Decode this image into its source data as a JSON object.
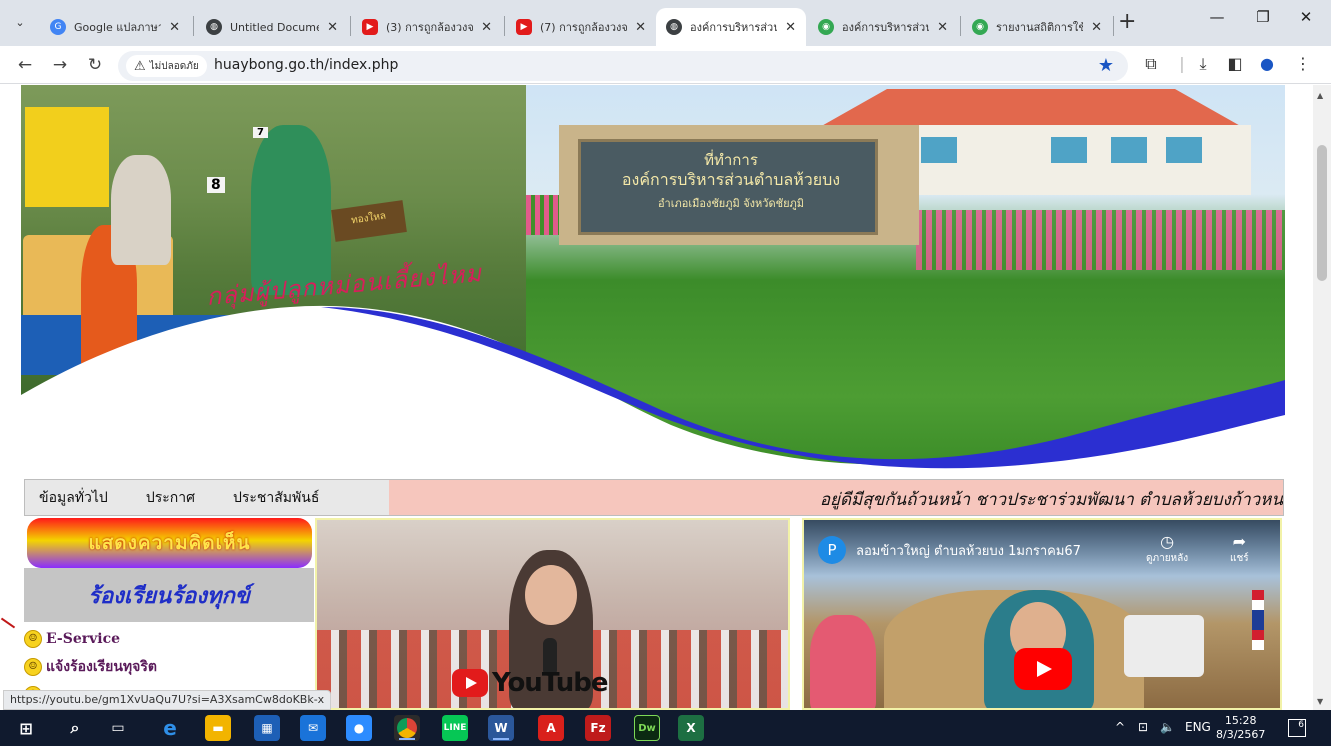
{
  "browser": {
    "tabs": [
      {
        "title": "Google แปลภาษา",
        "icon": "google-translate-icon",
        "active": false
      },
      {
        "title": "Untitled Docume",
        "icon": "globe-icon",
        "active": false
      },
      {
        "title": "(3) การถูกล้องวงจร",
        "icon": "youtube-icon",
        "active": false
      },
      {
        "title": "(7) การถูกล้องวงจร",
        "icon": "youtube-icon",
        "active": false
      },
      {
        "title": "องค์การบริหารส่วนต",
        "icon": "globe-icon",
        "active": true
      },
      {
        "title": "องค์การบริหารส่วนต",
        "icon": "green-site-icon",
        "active": false
      },
      {
        "title": "รายงานสถิติการใช้ง",
        "icon": "green-site-icon",
        "active": false
      }
    ],
    "new_tab": "+",
    "security_label": "ไม่ปลอดภัย",
    "url": "huaybong.go.th/index.php",
    "status_url": "https://youtu.be/gm1XvUaQu7U?si=A3XsamCw8doKBk-x"
  },
  "banner": {
    "sign_line1": "ที่ทำการ",
    "sign_line2": "องค์การบริหารส่วนตำบลห้วยบง",
    "sign_line3": "อำเภอเมืองชัยภูมิ   จังหวัดชัยภูมิ",
    "caption": "กลุ่มผู้ปลูกหม่อนเลี้ยงไหม",
    "wood_sign": "ทองใหล",
    "booth_number": "8",
    "booth_number2": "7"
  },
  "nav": {
    "items": [
      "ข้อมูลทั่วไป",
      "ประกาศ",
      "ประชาสัมพันธ์"
    ],
    "marquee": "อยู่ดีมีสุขกันถ้วนหน้า ชาวประชาร่วมพัฒนา ตำบลห้วยบงก้าวหน"
  },
  "sidebar": {
    "opinion_button": "แสดงความคิดเห็น",
    "complaint_title": "ร้องเรียนร้องทุกข์",
    "links": [
      "E-Service",
      "แจ้งร้องเรียนทุจริต"
    ]
  },
  "video1": {
    "youtube_word": "YouTube"
  },
  "video2": {
    "channel_initial": "P",
    "title": "ลอมข้าวใหญ่ ตำบลห้วยบง 1มกราคม67",
    "watch_later": "ดูภายหลัง",
    "share": "แชร์"
  },
  "taskbar": {
    "lang": "ENG",
    "time": "15:28",
    "date": "8/3/2567",
    "notifications": "6"
  },
  "colors": {
    "nav_marquee_bg": "#f6c6bd",
    "wave_blue": "#2b2fd1",
    "complaint_text": "#1f2ec7",
    "youtube_red": "#ff0000"
  }
}
